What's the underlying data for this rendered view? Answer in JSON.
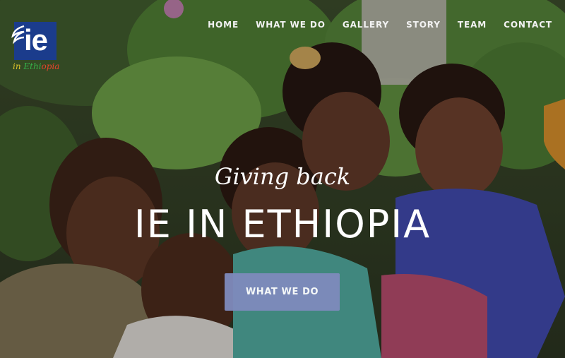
{
  "nav": {
    "items": [
      {
        "label": "HOME"
      },
      {
        "label": "WHAT WE DO"
      },
      {
        "label": "GALLERY"
      },
      {
        "label": "STORY"
      },
      {
        "label": "TEAM"
      },
      {
        "label": "CONTACT"
      }
    ]
  },
  "logo": {
    "mark": "ie",
    "sub_part1": "in ",
    "sub_part2": "Ethi",
    "sub_part3": "opia",
    "colors": {
      "box": "#1b3c8c",
      "yellow": "#d9c12a",
      "green": "#36b24a",
      "red": "#e8452c"
    }
  },
  "hero": {
    "tagline": "Giving back",
    "headline": "IE IN ETHIOPIA",
    "cta_label": "WHAT WE DO",
    "cta_color": "#7f8bbd",
    "background_image": "photo of smiling children among green foliage"
  }
}
